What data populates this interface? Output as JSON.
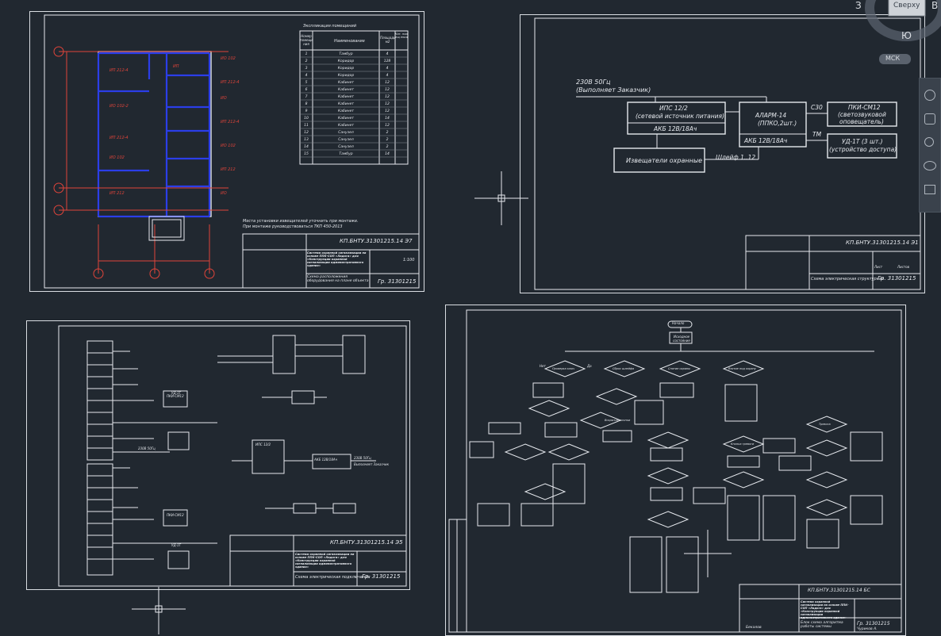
{
  "viewcube": {
    "top_label": "Сверху",
    "west": "З",
    "east": "В",
    "south": "Ю",
    "ucs": "МСК"
  },
  "sheet1": {
    "code": "КП.БНТУ.31301215.14  Э7",
    "title": "Система охранной сигнализации на основе ППК-СОП «Ладога» для «Конструкции охранной сигнализации административного здания»",
    "scale": "1:100",
    "group": "Гр. 31301215",
    "plan_label": "Схема расположения оборудования на плане объекта",
    "note_line1": "Места установки извещателей уточнить при монтаже.",
    "note_line2": "При монтаже руководствоваться ТКП 450-2013",
    "table_title": "Экспликация помещений",
    "col1": "Номер помеще ния",
    "col2": "Наименование",
    "col3": "Площадь м2",
    "col4": "Кат. пом ещ ения",
    "rows": [
      {
        "n": "1",
        "name": "Тамбур",
        "area": "4"
      },
      {
        "n": "2",
        "name": "Коридор",
        "area": "128"
      },
      {
        "n": "3",
        "name": "Коридор",
        "area": "4"
      },
      {
        "n": "4",
        "name": "Коридор",
        "area": "4"
      },
      {
        "n": "5",
        "name": "Кабинет",
        "area": "12"
      },
      {
        "n": "6",
        "name": "Кабинет",
        "area": "12"
      },
      {
        "n": "7",
        "name": "Кабинет",
        "area": "12"
      },
      {
        "n": "8",
        "name": "Кабинет",
        "area": "12"
      },
      {
        "n": "9",
        "name": "Кабинет",
        "area": "12"
      },
      {
        "n": "10",
        "name": "Кабинет",
        "area": "14"
      },
      {
        "n": "11",
        "name": "Кабинет",
        "area": "12"
      },
      {
        "n": "12",
        "name": "Санузел",
        "area": "2"
      },
      {
        "n": "13",
        "name": "Санузел",
        "area": "2"
      },
      {
        "n": "14",
        "name": "Санузел",
        "area": "2"
      },
      {
        "n": "15",
        "name": "Тамбур",
        "area": "14"
      }
    ],
    "axes": [
      "А",
      "Б",
      "В",
      "1",
      "2",
      "3"
    ]
  },
  "sheet2": {
    "code": "КП.БНТУ.31301215.14  Э1",
    "group": "Гр. 31301215",
    "label": "Схема электрическая структурная",
    "supply": "230В 50Гц",
    "supply_note": "(Выполняет Заказчик)",
    "ips": "ИПС 12/2",
    "ips_sub": "(сетевой источник питания)",
    "ips_akb": "АКБ 12В/18Ач",
    "alarm": "АЛАРМ-14",
    "alarm_sub": "(ППКО,2шт.)",
    "alarm_akb": "АКБ 12В/18Ач",
    "pki": "ПКИ-СМ12",
    "pki_sub": "(светозвуковой",
    "pki_sub2": "оповещатель)",
    "ud": "УД-1Т (3 шт.)",
    "ud_sub": "(устройство доступа)",
    "det": "Извещатели охранные",
    "loop": "Шлейф  1..12",
    "c30": "С30",
    "tm": "ТМ",
    "sheet_label": "Лист",
    "sheets_label": "Листов"
  },
  "sheet3": {
    "code": "КП.БНТУ.31301215.14  Э5",
    "group": "Гр. 31301215",
    "label": "Схема электрическая подключения",
    "title": "Система охранной сигнализации на основе ППК-СОП «Ладога» для «Конструкции охранной сигнализации административного здания»",
    "pki1": "ПКИ-СМ12",
    "pki2": "ПКИ-СМ12",
    "ud1": "УД-1Т",
    "ud2": "УД-1Т",
    "ips": "ИПС 12/2",
    "akb": "АКБ 12В/18Ач",
    "s230": "230В 50Гц",
    "s230b": "230В 50Гц",
    "note": "Выполняет Заказчик"
  },
  "sheet4": {
    "code": "КП.БНТУ.31301215.14  БС",
    "group": "Гр. 31301215",
    "label": "Блок схема алгоритма работы системы",
    "title": "Система охранной сигнализации на основе ППК-СОП «Ладога» для «Конструкции охранной сигнализации административного здания»",
    "start": "Начало",
    "init": "Исходное состояние",
    "yes": "Да",
    "no": "Нет",
    "sign1": "Бекалов",
    "sign2": "Чуриков А.",
    "checks": [
      "Проверка ключ",
      "Сброс шлейфа",
      "Вскрытие кнопки",
      "Снятие охраны",
      "Взятие под охрану",
      "Тревога",
      "Кнопка тревоги"
    ]
  }
}
